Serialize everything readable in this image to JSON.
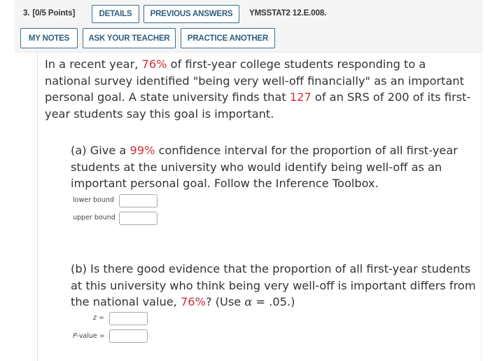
{
  "header": {
    "question_number": "3.",
    "points": "[0/5 Points]",
    "buttons": {
      "details": "DETAILS",
      "previous_answers": "PREVIOUS ANSWERS",
      "my_notes": "MY NOTES",
      "ask_teacher": "ASK YOUR TEACHER",
      "practice_another": "PRACTICE ANOTHER"
    },
    "reference_code": "YMSSTAT2 12.E.008."
  },
  "colors": {
    "highlight": "#d22f3a",
    "button_border": "#3a6f8f",
    "button_text": "#2e5f7e",
    "header_bg": "#f5f5f5"
  },
  "intro": {
    "t1": "In a recent year, ",
    "pct": "76%",
    "t2": " of first-year college students responding to a national survey identified \"being very well-off financially\" as an important personal goal. A state university finds that ",
    "count": "127",
    "t3": " of an SRS of 200 of its first-year students say this goal is important."
  },
  "part_a": {
    "t1": "(a) Give a ",
    "conf": "99%",
    "t2": " confidence interval for the proportion of all first-year students at the university who would identify being well-off as an important personal goal. Follow the Inference Toolbox.",
    "fields": {
      "lower_label": "lower bound",
      "lower_value": "",
      "upper_label": "upper bound",
      "upper_value": ""
    }
  },
  "part_b": {
    "t1": "(b) Is there good evidence that the proportion of all first-year students at this university who think being very well-off is important differs from the national value, ",
    "pct": "76%",
    "t2": "? (Use ",
    "alpha_symbol": "α",
    "t3": " = .05.)",
    "fields": {
      "z_label": "z",
      "z_eq": " =",
      "z_value": "",
      "p_label": "P",
      "p_rest": "-value =",
      "p_value": ""
    }
  }
}
